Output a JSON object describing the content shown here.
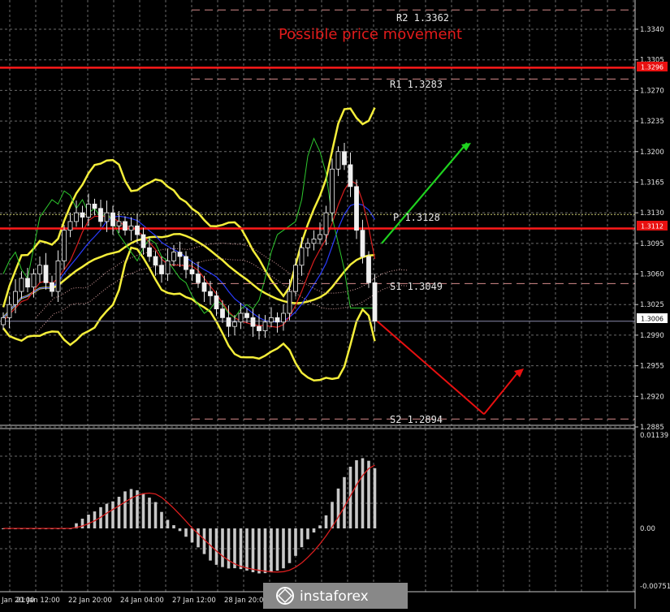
{
  "chart_data": [
    {
      "type": "line",
      "title": "Possible price movement",
      "xlabel": "",
      "ylabel": "",
      "grid": true,
      "ylim": [
        1.2875,
        1.338
      ],
      "y_ticks": [
        "1.3340",
        "1.3305",
        "1.3270",
        "1.3235",
        "1.3200",
        "1.3165",
        "1.3130",
        "1.3095",
        "1.3060",
        "1.3025",
        "1.2990",
        "1.2955",
        "1.2920",
        "1.2885"
      ],
      "x_ticks": [
        "1 Jan 20:00",
        "21 Jan 12:00",
        "22 Jan 20:00",
        "24 Jan 04:00",
        "27 Jan 12:00",
        "28 Jan 20:00"
      ],
      "levels": [
        {
          "name": "R2",
          "value": 1.3362,
          "text": "R2 1.3362"
        },
        {
          "name": "R1",
          "value": 1.3283,
          "text": "R1 1.3283"
        },
        {
          "name": "P",
          "value": 1.3128,
          "text": "P 1.3128"
        },
        {
          "name": "S1",
          "value": 1.3049,
          "text": "S1 1.3049"
        },
        {
          "name": "S2",
          "value": 1.2894,
          "text": "S2 1.2894"
        }
      ],
      "resistance_lines": [
        {
          "value": 1.3296,
          "label": "1.3296"
        },
        {
          "value": 1.3112,
          "label": "1.3112"
        }
      ],
      "current_price": {
        "value": 1.3006,
        "label": "1.3006"
      },
      "close_series": [
        1.301,
        1.3025,
        1.304,
        1.3055,
        1.3045,
        1.306,
        1.307,
        1.305,
        1.304,
        1.3075,
        1.311,
        1.312,
        1.313,
        1.3125,
        1.314,
        1.3135,
        1.312,
        1.313,
        1.3115,
        1.312,
        1.311,
        1.3115,
        1.3105,
        1.309,
        1.308,
        1.307,
        1.306,
        1.3075,
        1.3085,
        1.308,
        1.3065,
        1.306,
        1.305,
        1.304,
        1.3035,
        1.302,
        1.301,
        1.3,
        1.3005,
        1.3015,
        1.301,
        1.3,
        1.2995,
        1.3005,
        1.301,
        1.3005,
        1.3015,
        1.304,
        1.307,
        1.309,
        1.3095,
        1.31,
        1.3105,
        1.313,
        1.318,
        1.32,
        1.3185,
        1.316,
        1.311,
        1.308,
        1.305,
        1.3006
      ],
      "forecast": {
        "up_target": 1.321,
        "down_target": 1.2894,
        "rebound_target": 1.295
      },
      "oscillator": {
        "y_ticks": [
          "0.01139",
          "0.00",
          "-0.00751"
        ],
        "ylim": [
          -0.00751,
          0.01139
        ]
      }
    }
  ],
  "logo": {
    "text": "instaforex"
  }
}
